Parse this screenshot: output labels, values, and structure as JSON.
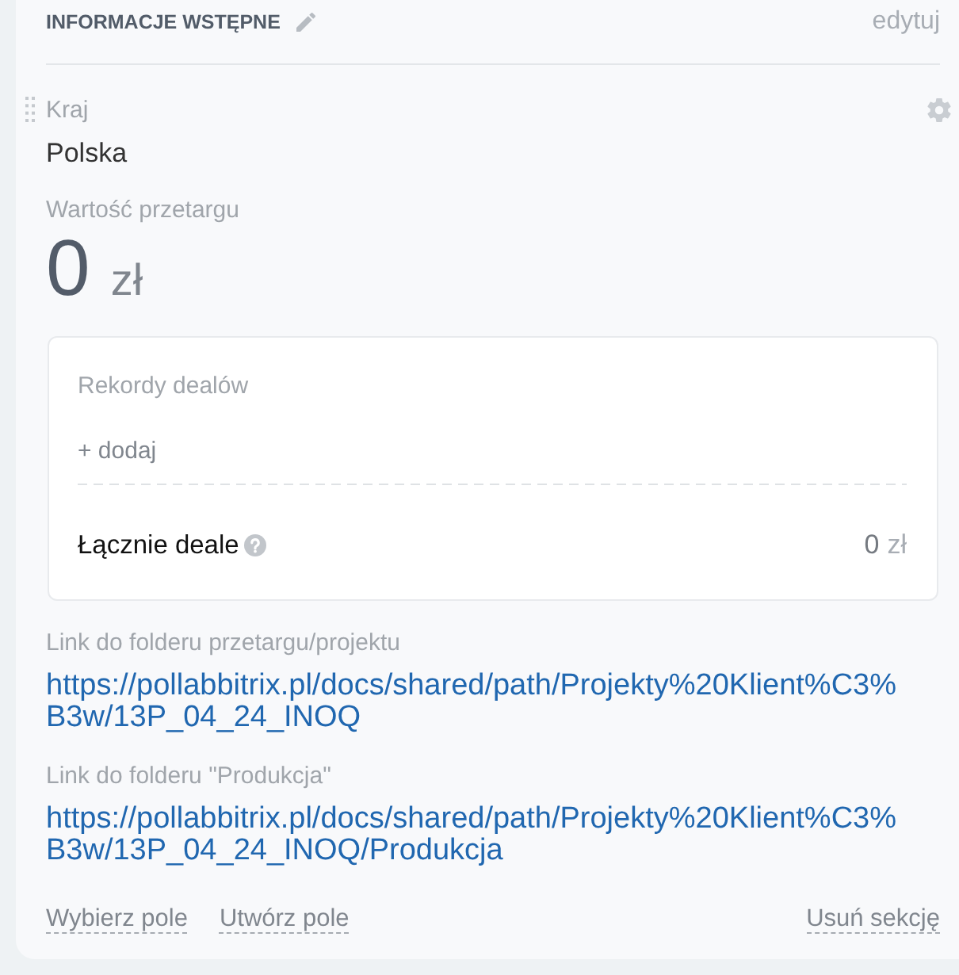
{
  "section": {
    "title": "INFORMACJE WSTĘPNE",
    "edit_link": "edytuj"
  },
  "fields": [
    {
      "kind": "text",
      "label": "Kraj",
      "value": "Polska",
      "hovered": true
    },
    {
      "kind": "money",
      "label": "Wartość przetargu",
      "amount": "0",
      "currency": "zł",
      "hovered": false
    },
    {
      "kind": "deals",
      "label": "Rekordy dealów",
      "add_link": "+ dodaj",
      "total_label": "Łącznie deale",
      "total_amount": "0",
      "total_currency": "zł",
      "hovered": false
    },
    {
      "kind": "link",
      "label": "Link do folderu przetargu/projektu",
      "value": "https://pollabbitrix.pl/docs/shared/path/Projekty%20Klient%C3%B3w/13P_04_24_INOQ",
      "hovered": false
    },
    {
      "kind": "link",
      "label": "Link do folderu \"Produkcja\"",
      "value": "https://pollabbitrix.pl/docs/shared/path/Projekty%20Klient%C3%B3w/13P_04_24_INOQ/Produkcja",
      "hovered": false
    }
  ],
  "footer": {
    "actions": [
      "Wybierz pole",
      "Utwórz pole"
    ],
    "remove_link": "Usuń sekcję"
  }
}
